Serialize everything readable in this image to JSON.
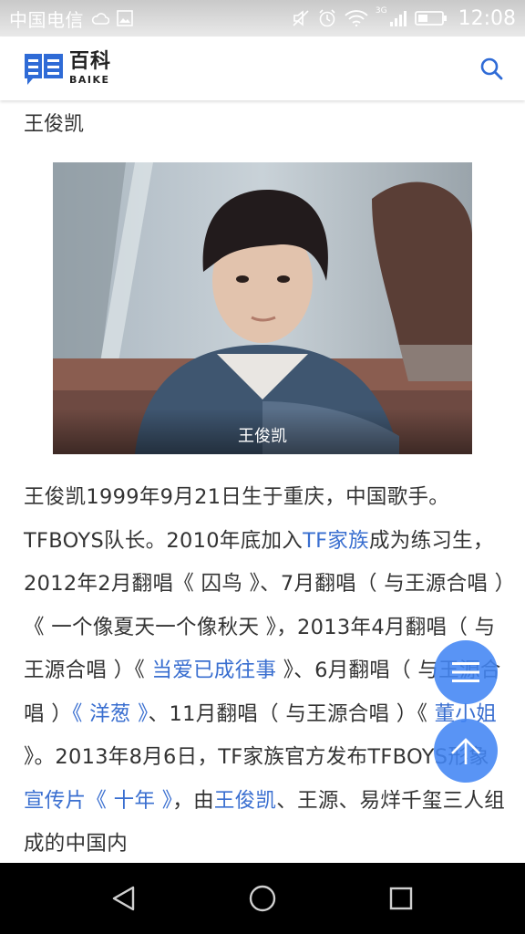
{
  "status_bar": {
    "carrier": "中国电信",
    "network_type": "3G",
    "time": "12:08",
    "icons": [
      "cloud-icon",
      "image-icon",
      "mute-icon",
      "alarm-icon",
      "wifi-icon",
      "signal-icon",
      "battery-icon"
    ]
  },
  "header": {
    "logo_cn": "百科",
    "logo_en": "BAIKE",
    "brand_color": "#2f6bd6",
    "search_icon": "search-icon"
  },
  "entry": {
    "title": "王俊凯",
    "image_caption": "王俊凯"
  },
  "article": {
    "segments": [
      {
        "text": "王俊凯1999年9月21日生于重庆，中国歌手。TFBOYS队长。2010年底加入",
        "link": false
      },
      {
        "text": "TF家族",
        "link": true
      },
      {
        "text": "成为练习生，2012年2月翻唱《 囚鸟 》、7月翻唱（ 与王源合唱 ）《 一个像夏天一个像秋天 》，2013年4月翻唱（ 与王源合唱 ）《 ",
        "link": false
      },
      {
        "text": "当爱已成往事",
        "link": true
      },
      {
        "text": " 》、6月翻唱（ 与王源合唱 ）",
        "link": false
      },
      {
        "text": "《 洋葱 》",
        "link": true
      },
      {
        "text": "、11月翻唱（ 与王源合唱 ）《 ",
        "link": false
      },
      {
        "text": "董小姐",
        "link": true
      },
      {
        "text": " 》。2013年8月6日，TF家族官方发布TFBOYS形象",
        "link": false
      },
      {
        "text": "宣传片《 十年 》",
        "link": true
      },
      {
        "text": "，由",
        "link": false
      },
      {
        "text": "王俊凯",
        "link": true
      },
      {
        "text": "、王源、易烊千玺三人组成的中国内",
        "link": false
      }
    ],
    "link_color": "#3a6fd0"
  },
  "fabs": {
    "menu_icon": "menu-icon",
    "top_icon": "arrow-up-icon",
    "color": "#4285f4"
  },
  "nav_bar": {
    "icons": [
      "back-icon",
      "home-icon",
      "recents-icon"
    ]
  }
}
